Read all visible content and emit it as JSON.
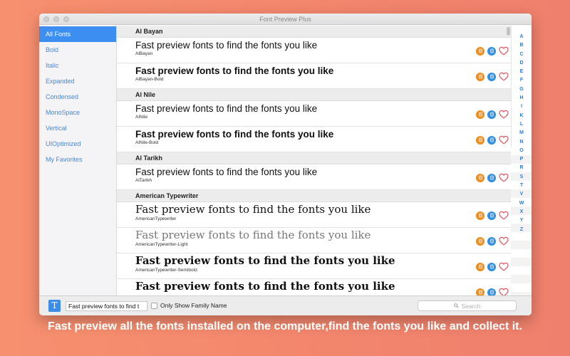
{
  "window": {
    "title": "Font Preview Plus"
  },
  "sidebar": {
    "items": [
      {
        "label": "All Fonts",
        "active": true
      },
      {
        "label": "Bold"
      },
      {
        "label": "Italic"
      },
      {
        "label": "Expanded"
      },
      {
        "label": "Condensed"
      },
      {
        "label": "MonoSpace"
      },
      {
        "label": "Vertical"
      },
      {
        "label": "UIOptimized"
      },
      {
        "label": "My Favorites"
      }
    ]
  },
  "list": {
    "groups": [
      {
        "name": "Al Bayan",
        "rows": [
          {
            "sample": "Fast preview fonts to find the fonts you like",
            "font": "AlBayan",
            "style": "regular"
          },
          {
            "sample": "Fast preview fonts to find the fonts you like",
            "font": "AlBayan-Bold",
            "style": "bold"
          }
        ]
      },
      {
        "name": "Al Nile",
        "rows": [
          {
            "sample": "Fast preview fonts to find the fonts you like",
            "font": "AlNile",
            "style": "regular"
          },
          {
            "sample": "Fast preview fonts to find the fonts you like",
            "font": "AlNile-Bold",
            "style": "bold"
          }
        ]
      },
      {
        "name": "Al Tarikh",
        "rows": [
          {
            "sample": "Fast preview fonts to find the fonts you like",
            "font": "AlTarikh",
            "style": "regular"
          }
        ]
      },
      {
        "name": "American Typewriter",
        "rows": [
          {
            "sample": "Fast preview fonts to find the fonts you like",
            "font": "AmericanTypewriter",
            "style": "mono"
          },
          {
            "sample": "Fast preview fonts to find the fonts you like",
            "font": "AmericanTypewriter-Light",
            "style": "mono-light"
          },
          {
            "sample": "Fast preview fonts to find the fonts you like",
            "font": "AmericanTypewriter-Semibold",
            "style": "mono-bold"
          },
          {
            "sample": "Fast preview fonts to find the fonts you like",
            "font": "",
            "style": "mono-bold"
          }
        ]
      }
    ]
  },
  "alphabet": [
    "A",
    "B",
    "C",
    "D",
    "E",
    "F",
    "G",
    "H",
    "I",
    "K",
    "L",
    "M",
    "N",
    "O",
    "P",
    "R",
    "S",
    "T",
    "V",
    "W",
    "X",
    "Y",
    "Z"
  ],
  "bottombar": {
    "text_button": "T",
    "preview_text": "Fast preview fonts to find t",
    "checkbox_label": "Only Show Family Name",
    "search_placeholder": "Search"
  },
  "caption": "Fast preview all the fonts installed on the computer,find the fonts you like and collect it.",
  "colors": {
    "accent": "#3d8ef1",
    "orange": "#f08c1a",
    "blue": "#2f8fe0",
    "heart": "#e84b5a"
  }
}
